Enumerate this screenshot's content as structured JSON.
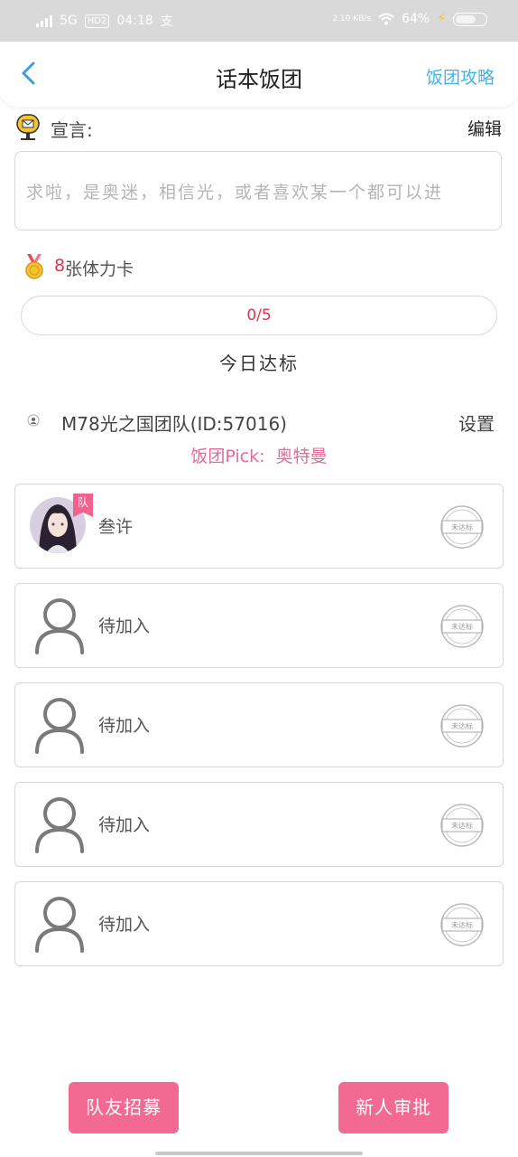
{
  "status_bar": {
    "network": "5G",
    "hd": "HD2",
    "time": "04:18",
    "app_glyph": "支",
    "speed": "2.10 KB/s",
    "battery": "64%"
  },
  "nav": {
    "title": "话本饭团",
    "right_link": "饭团攻略"
  },
  "declaration": {
    "label": "宣言:",
    "edit": "编辑",
    "text": "求啦，是奥迷，相信光，或者喜欢某一个都可以进"
  },
  "stamina": {
    "count": "8",
    "label": "张体力卡"
  },
  "progress": {
    "text": "0/5",
    "fraction": 0,
    "caption": "今日达标"
  },
  "team": {
    "name": "M78光之国团队(ID:57016)",
    "settings": "设置",
    "pick_label": "饭团Pick:",
    "pick_value": "奥特曼"
  },
  "members": [
    {
      "name": "叁许",
      "badge": "队",
      "status": "未达标",
      "has_avatar": true
    },
    {
      "name": "待加入",
      "status": "未达标",
      "has_avatar": false
    },
    {
      "name": "待加入",
      "status": "未达标",
      "has_avatar": false
    },
    {
      "name": "待加入",
      "status": "未达标",
      "has_avatar": false
    },
    {
      "name": "待加入",
      "status": "未达标",
      "has_avatar": false
    }
  ],
  "buttons": {
    "recruit": "队友招募",
    "review": "新人审批"
  },
  "colors": {
    "accent_pink": "#f26a91",
    "link_blue": "#45b3e6",
    "red_text": "#e0344f",
    "pick_pink": "#e46b97"
  }
}
